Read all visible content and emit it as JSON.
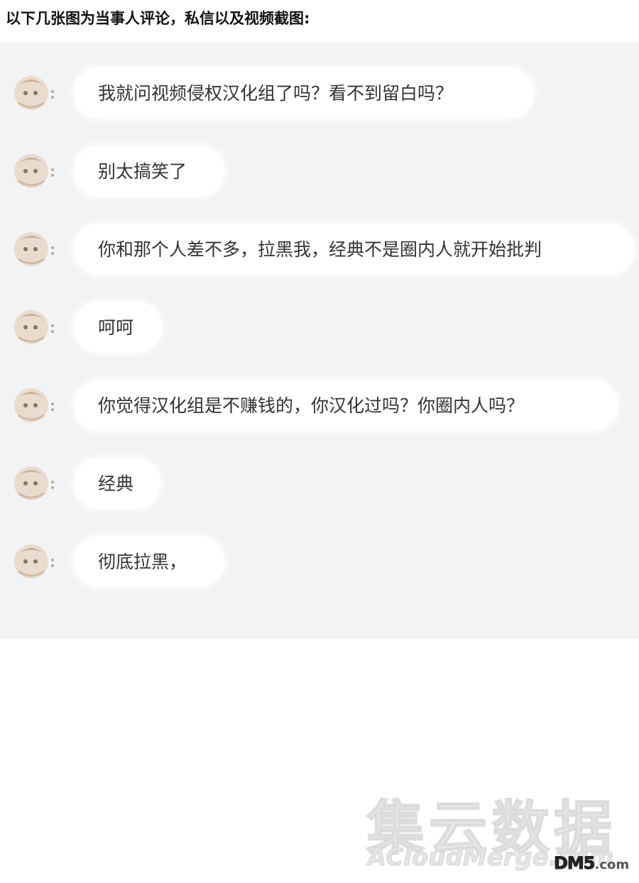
{
  "header": {
    "title": "以下几张图为当事人评论，私信以及视频截图:"
  },
  "messages": [
    {
      "text": "我就问视频侵权汉化组了吗？看不到留白吗？"
    },
    {
      "text": "别太搞笑了"
    },
    {
      "text": "你和那个人差不多，拉黑我，经典不是圈内人就开始批判"
    },
    {
      "text": "呵呵"
    },
    {
      "text": "你觉得汉化组是不赚钱的，你汉化过吗？你圈内人吗？"
    },
    {
      "text": "经典"
    },
    {
      "text": "彻底拉黑，"
    }
  ],
  "watermark": {
    "chinese": "集云数据",
    "english": "ACloudMerge.com",
    "logo_main": "DM5",
    "logo_suffix": ".com"
  }
}
